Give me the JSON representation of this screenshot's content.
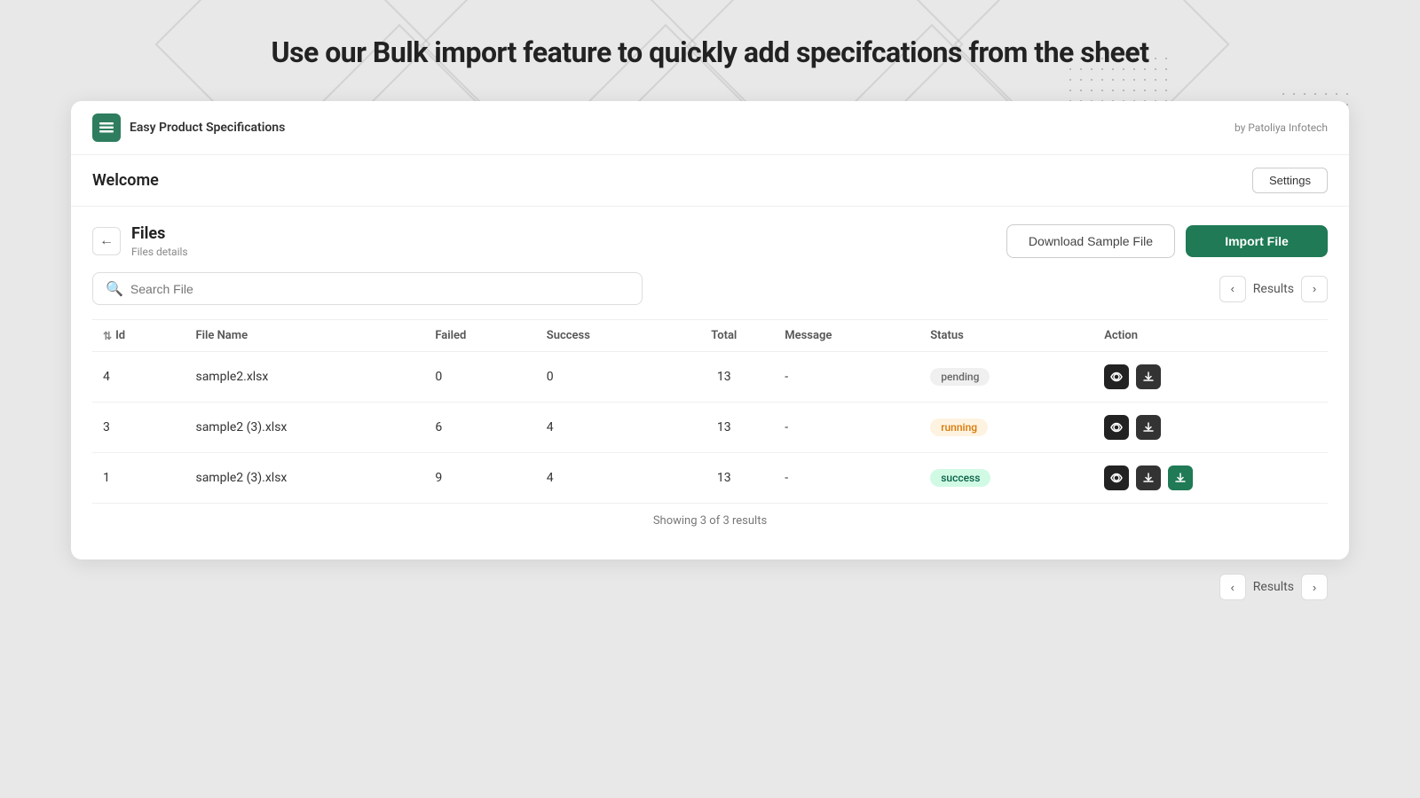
{
  "headline": "Use our Bulk import feature to quickly add specifcations from the sheet",
  "app": {
    "brand_icon": "☰",
    "brand_name": "Easy Product Specifications",
    "by_label": "by Patoliya Infotech"
  },
  "welcome": {
    "text": "Welcome",
    "settings_label": "Settings"
  },
  "files": {
    "title": "Files",
    "subtitle": "Files details",
    "back_btn_label": "←",
    "download_sample_label": "Download Sample File",
    "import_file_label": "Import File"
  },
  "search": {
    "placeholder": "Search File"
  },
  "pagination": {
    "results_label": "Results",
    "prev_icon": "‹",
    "next_icon": "›"
  },
  "table": {
    "columns": [
      "Id",
      "File Name",
      "Failed",
      "Success",
      "Total",
      "Message",
      "Status",
      "Action"
    ],
    "rows": [
      {
        "id": 4,
        "file_name": "sample2.xlsx",
        "failed": 0,
        "success": 0,
        "total": 13,
        "message": "-",
        "status": "pending"
      },
      {
        "id": 3,
        "file_name": "sample2 (3).xlsx",
        "failed": 6,
        "success": 4,
        "total": 13,
        "message": "-",
        "status": "running"
      },
      {
        "id": 1,
        "file_name": "sample2 (3).xlsx",
        "failed": 9,
        "success": 4,
        "total": 13,
        "message": "-",
        "status": "success"
      }
    ],
    "showing_text": "Showing 3 of 3 results"
  },
  "colors": {
    "brand_green": "#1f7a55",
    "badge_pending_bg": "#f0f0f0",
    "badge_pending_text": "#666",
    "badge_running_bg": "#fef3e0",
    "badge_running_text": "#d97706",
    "badge_success_bg": "#d1fae5",
    "badge_success_text": "#065f46"
  }
}
